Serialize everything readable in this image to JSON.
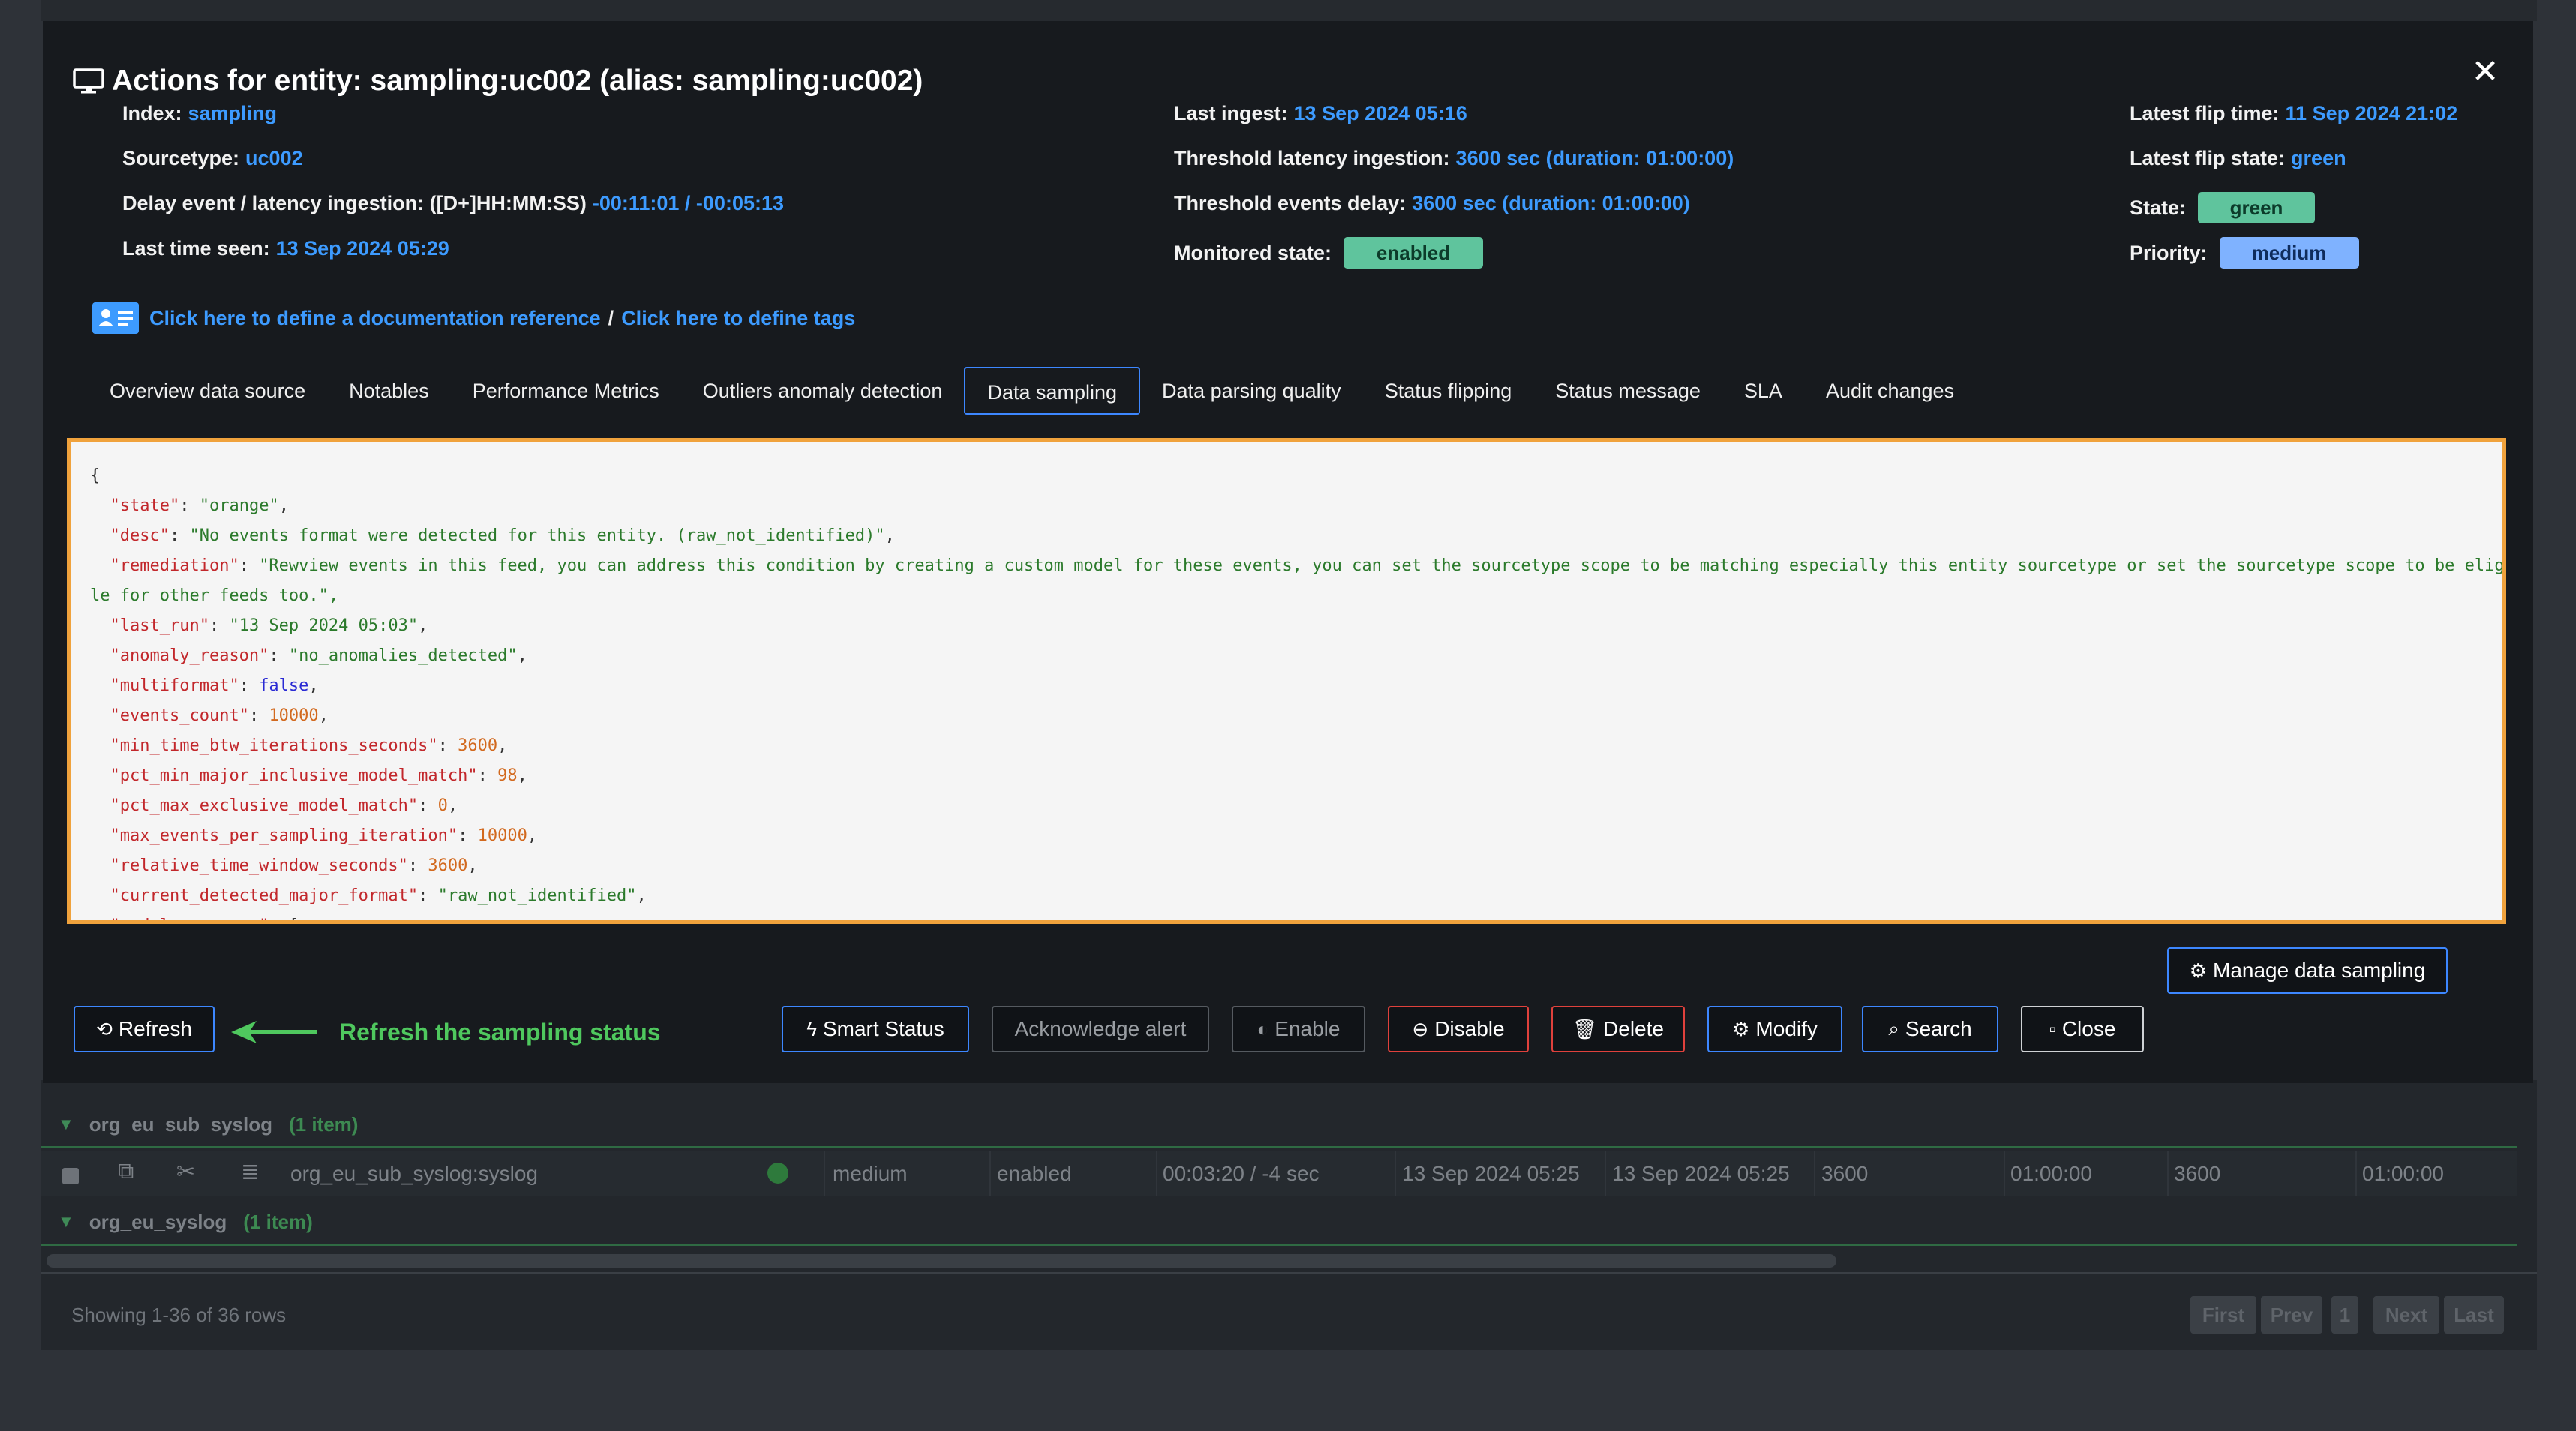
{
  "modal": {
    "title": "Actions for entity: sampling:uc002 (alias: sampling:uc002)",
    "close_symbol": "✕",
    "index_label": "Index:",
    "index_value": "sampling",
    "sourcetype_label": "Sourcetype:",
    "sourcetype_value": "uc002",
    "delay_label": "Delay event / latency ingestion: ([D+]HH:MM:SS)",
    "delay_value": "-00:11:01 / -00:05:13",
    "last_seen_label": "Last time seen:",
    "last_seen_value": "13 Sep 2024 05:29",
    "last_ingest_label": "Last ingest:",
    "last_ingest_value": "13 Sep 2024 05:16",
    "threshold_latency_label": "Threshold latency ingestion:",
    "threshold_latency_value": "3600 sec (duration: 01:00:00)",
    "threshold_delay_label": "Threshold events delay:",
    "threshold_delay_value": "3600 sec (duration: 01:00:00)",
    "monitored_label": "Monitored state:",
    "monitored_value": "enabled",
    "flip_time_label": "Latest flip time:",
    "flip_time_value": "11 Sep 2024 21:02",
    "flip_state_label": "Latest flip state:",
    "flip_state_value": "green",
    "state_label": "State:",
    "state_value": "green",
    "priority_label": "Priority:",
    "priority_value": "medium",
    "doc_link": "Click here to define a documentation reference",
    "doc_sep": "/",
    "tags_link": "Click here to define tags",
    "tabs": [
      "Overview data source",
      "Notables",
      "Performance Metrics",
      "Outliers anomaly detection",
      "Data sampling",
      "Data parsing quality",
      "Status flipping",
      "Status message",
      "SLA",
      "Audit changes"
    ],
    "active_tab": "Data sampling"
  },
  "json_lines": [
    {
      "t": "p",
      "v": "{"
    },
    {
      "k": "\"state\"",
      "v": "\"orange\"",
      "c": "s"
    },
    {
      "k": "\"desc\"",
      "v": "\"No events format were detected for this entity. (raw_not_identified)\"",
      "c": "s"
    },
    {
      "k": "\"remediation\"",
      "v": "\"Rewview events in this feed, you can address this condition by creating a custom model for these events, you can set the sourcetype scope to be matching especially this entity sourcetype or set the sourcetype scope to be eligib",
      "c": "s",
      "nocomma": true
    },
    {
      "t": "cont",
      "v": "le for other feeds too.\","
    },
    {
      "k": "\"last_run\"",
      "v": "\"13 Sep 2024 05:03\"",
      "c": "s"
    },
    {
      "k": "\"anomaly_reason\"",
      "v": "\"no_anomalies_detected\"",
      "c": "s"
    },
    {
      "k": "\"multiformat\"",
      "v": "false",
      "c": "b"
    },
    {
      "k": "\"events_count\"",
      "v": "10000",
      "c": "n"
    },
    {
      "k": "\"min_time_btw_iterations_seconds\"",
      "v": "3600",
      "c": "n"
    },
    {
      "k": "\"pct_min_major_inclusive_model_match\"",
      "v": "98",
      "c": "n"
    },
    {
      "k": "\"pct_max_exclusive_model_match\"",
      "v": "0",
      "c": "n"
    },
    {
      "k": "\"max_events_per_sampling_iteration\"",
      "v": "10000",
      "c": "n"
    },
    {
      "k": "\"relative_time_window_seconds\"",
      "v": "3600",
      "c": "n"
    },
    {
      "k": "\"current_detected_major_format\"",
      "v": "\"raw_not_identified\"",
      "c": "s"
    },
    {
      "k": "\"models_summary\"",
      "v": "[",
      "c": "p",
      "nocomma": true
    }
  ],
  "buttons": {
    "manage": "Manage data sampling",
    "refresh": "Refresh",
    "hint": "Refresh the sampling status",
    "smart_status": "Smart Status",
    "acknowledge": "Acknowledge alert",
    "enable": "Enable",
    "disable": "Disable",
    "delete": "Delete",
    "modify": "Modify",
    "search": "Search",
    "close": "Close"
  },
  "background": {
    "group1_name": "org_eu_sub_syslog",
    "group1_count": "(1 item)",
    "group2_name": "org_eu_syslog",
    "group2_count": "(1 item)",
    "row": {
      "entity": "org_eu_sub_syslog:syslog",
      "priority": "medium",
      "monitored": "enabled",
      "delay": "00:03:20 / -4 sec",
      "last_ingest": "13 Sep 2024 05:25",
      "last_seen": "13 Sep 2024 05:25",
      "threshold1": "3600",
      "duration1": "01:00:00",
      "threshold2": "3600",
      "duration2": "01:00:00"
    },
    "showing": "Showing 1-36 of 36 rows",
    "pager": [
      "First",
      "Prev",
      "1",
      "Next",
      "Last"
    ]
  },
  "colors": {
    "accent": "#3d9bff",
    "green_pill": "#5fc49d",
    "blue_pill": "#7fb2ff",
    "json_border": "#f0a23c",
    "hint_green": "#4fc85e"
  }
}
